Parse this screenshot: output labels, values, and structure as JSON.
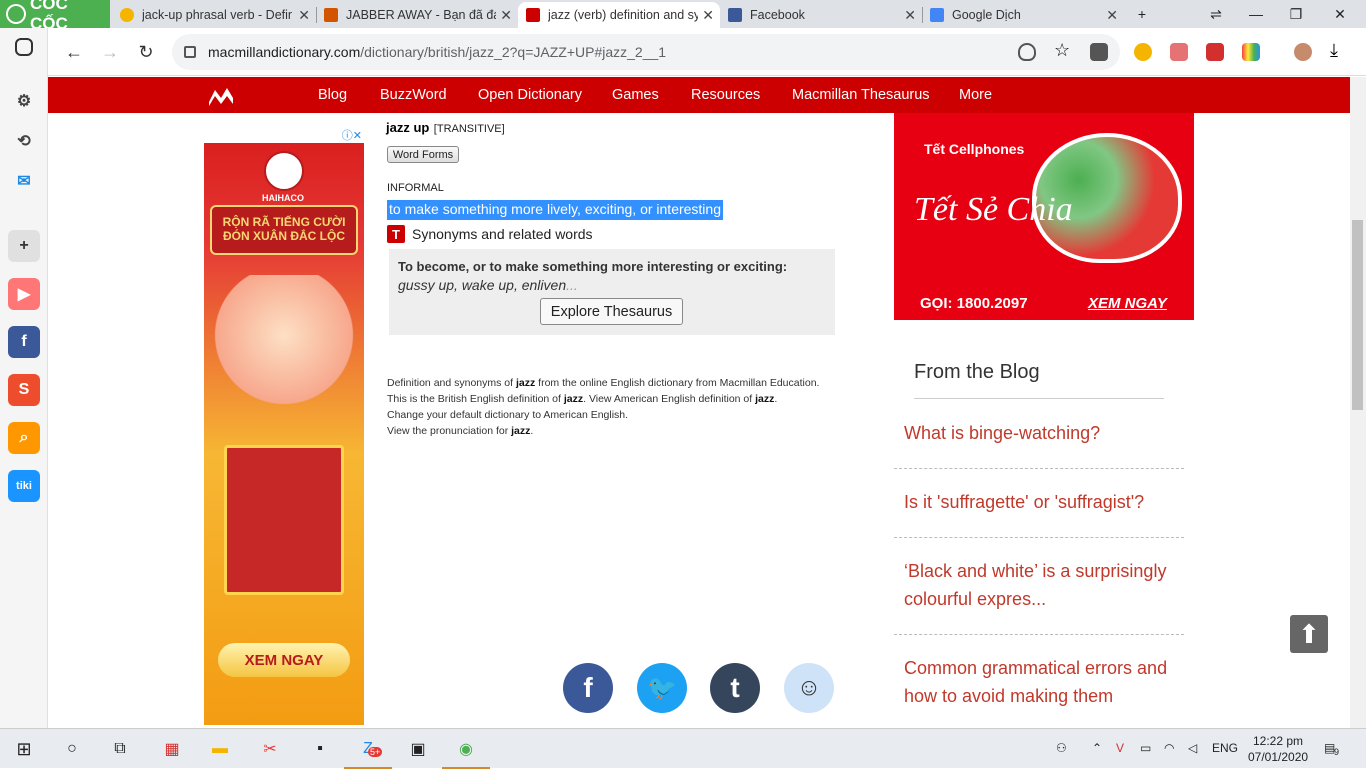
{
  "browser": {
    "brand": "CỐC CỐC",
    "tabs": [
      {
        "title": "jack-up phrasal verb - Defin",
        "favicon_color": "#f4b400"
      },
      {
        "title": "JABBER AWAY - Bạn đã đánh",
        "favicon_color": "#d35400"
      },
      {
        "title": "jazz (verb) definition and sy",
        "favicon_color": "#cc0000"
      },
      {
        "title": "Facebook",
        "favicon_color": "#3b5998"
      },
      {
        "title": "Google Dịch",
        "favicon_color": "#4285f4"
      }
    ],
    "url_host": "macmillandictionary.com",
    "url_path": "/dictionary/british/jazz_2?q=JAZZ+UP#jazz_2__1"
  },
  "site_nav": {
    "links": [
      "Blog",
      "BuzzWord",
      "Open Dictionary",
      "Games",
      "Resources",
      "Macmillan Thesaurus",
      "More"
    ],
    "color": "#cc0000"
  },
  "entry": {
    "headword": "jazz up",
    "grammar": "[TRANSITIVE]",
    "word_forms_button": "Word Forms",
    "register": "INFORMAL",
    "definition": "to make something more lively, exciting, or interesting",
    "synonyms_label": "Synonyms and related words",
    "thesaurus_heading": "To become, or to make something more interesting or exciting:",
    "thesaurus_words": "gussy up, wake up, enliven",
    "thesaurus_more": "...",
    "explore_button": "Explore Thesaurus"
  },
  "footnote": {
    "line1_a": "Definition and synonyms of ",
    "line1_b": "jazz",
    "line1_c": " from the online English dictionary from Macmillan Education.",
    "line2_a": "This is the British English definition of ",
    "line2_b": "jazz",
    "line2_c": ". View American English definition of ",
    "line2_d": "jazz",
    "line2_e": ".",
    "line3": "Change your default dictionary to American English.",
    "line4_a": "View the pronunciation for ",
    "line4_b": "jazz",
    "line4_c": "."
  },
  "ad_left": {
    "brand": "HAIHACO",
    "banner": "RỘN RÃ TIẾNG CƯỜI ĐÓN XUÂN ĐẮC LỘC",
    "cta": "XEM NGAY"
  },
  "ad_right": {
    "line1": "Tết Cellphones",
    "line2": "Tết Sẻ Chia",
    "phone": "GỌI: 1800.2097",
    "cta": "XEM NGAY"
  },
  "blog": {
    "title": "From the Blog",
    "items": [
      "What is binge-watching?",
      "Is it 'suffragette' or 'suffragist'?",
      "‘Black and white’ is a surprisingly colourful expres...",
      "Common grammatical errors and how to avoid making them"
    ]
  },
  "taskbar": {
    "lang": "ENG",
    "time": "12:22 pm",
    "date": "07/01/2020",
    "notif_count": "9",
    "zalo_badge": "5+"
  }
}
